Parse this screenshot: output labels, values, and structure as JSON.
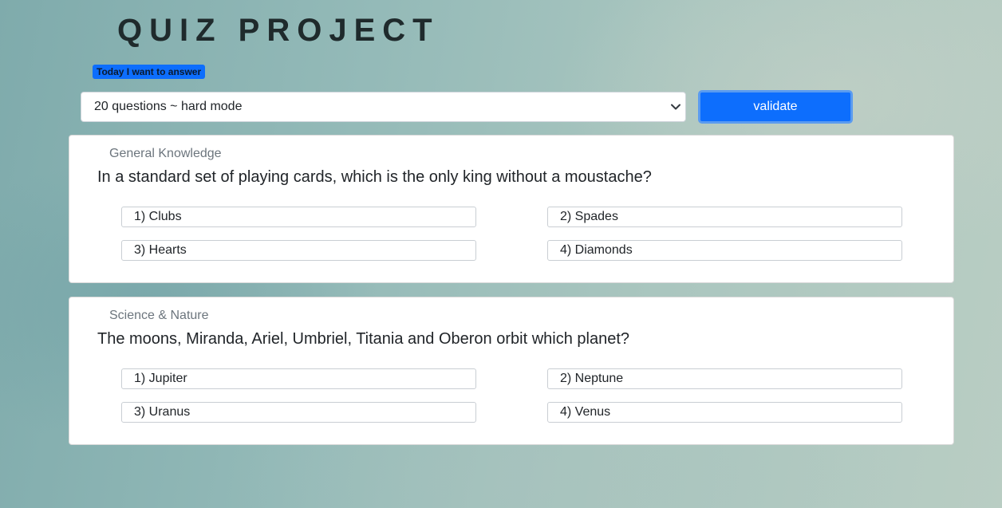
{
  "header": {
    "title": "QUIZ PROJECT",
    "badge": "Today I want to answer"
  },
  "controls": {
    "mode_select": {
      "selected": "20 questions ~ hard mode",
      "icon": "chevron-down-icon"
    },
    "validate_label": "validate"
  },
  "colors": {
    "accent": "#0d6efd",
    "card_background": "#ffffff",
    "category_text": "#6c757d"
  },
  "questions": [
    {
      "category": "General Knowledge",
      "text": "In a standard set of playing cards, which is the only king without a moustache?",
      "answers": [
        "1) Clubs",
        "2) Spades",
        "3) Hearts",
        "4) Diamonds"
      ]
    },
    {
      "category": "Science & Nature",
      "text": "The moons, Miranda, Ariel, Umbriel, Titania and Oberon orbit which planet?",
      "answers": [
        "1) Jupiter",
        "2) Neptune",
        "3) Uranus",
        "4) Venus"
      ]
    }
  ]
}
